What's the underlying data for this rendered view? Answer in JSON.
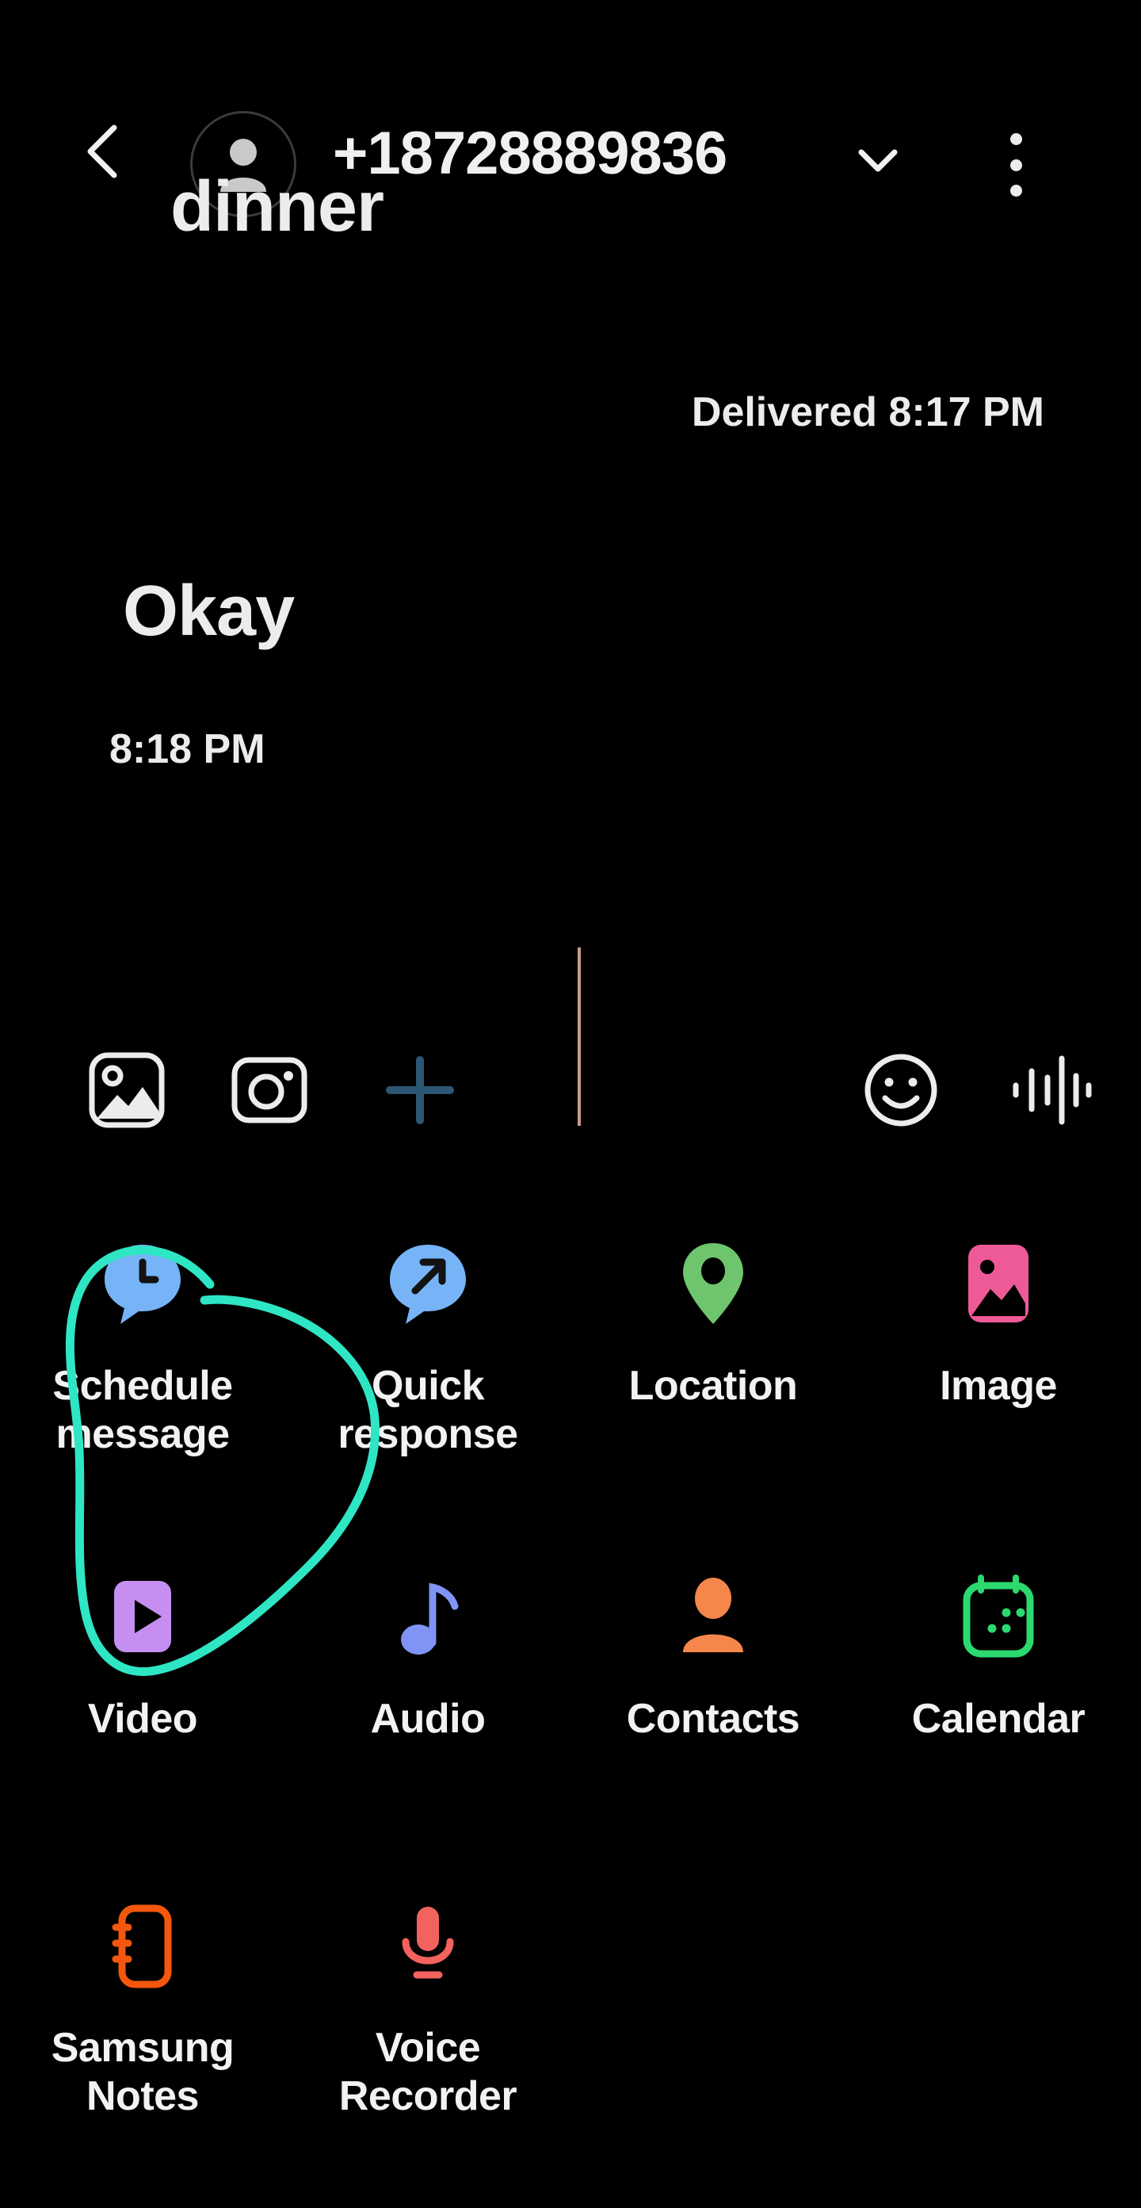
{
  "app": {
    "name": "Samsung Messages",
    "theme": "dark",
    "background_color": "#000000"
  },
  "header": {
    "back_icon": "chevron-left-icon",
    "avatar_icon": "person-avatar-icon",
    "contact": "+18728889836",
    "expand_icon": "chevron-down-icon",
    "overflow_icon": "more-vertical-icon"
  },
  "conversation": {
    "messages": [
      {
        "id": "msg-dinner",
        "text": "dinner",
        "direction": "incoming",
        "clipped": true
      },
      {
        "id": "msg-delivered",
        "text": "Delivered 8:17 PM",
        "direction": "outgoing-status"
      },
      {
        "id": "msg-okay",
        "text": "Okay",
        "direction": "incoming"
      },
      {
        "id": "msg-okay-time",
        "text": "8:18 PM",
        "direction": "incoming-timestamp"
      }
    ]
  },
  "input_toolbar": {
    "gallery_icon": "image-gallery-icon",
    "camera_icon": "camera-icon",
    "plus_icon": "plus-icon",
    "plus_color": "#2d5674",
    "cursor_color": "#c89b8a",
    "emoji_icon": "smiley-face-icon",
    "voice_icon": "voice-waveform-icon",
    "message_value": "",
    "message_placeholder": ""
  },
  "attachment_panel": {
    "items": [
      {
        "label": "Schedule message",
        "icon": "clock-bubble-icon",
        "color": "#76b4f7",
        "highlighted": true
      },
      {
        "label": "Quick response",
        "icon": "arrow-bubble-icon",
        "color": "#76b4f7",
        "highlighted": false
      },
      {
        "label": "Location",
        "icon": "map-pin-icon",
        "color": "#6ec56e",
        "highlighted": false
      },
      {
        "label": "Image",
        "icon": "photo-icon",
        "color": "#ee5998",
        "highlighted": false
      },
      {
        "label": "Video",
        "icon": "video-play-icon",
        "color": "#c58ef0",
        "highlighted": false
      },
      {
        "label": "Audio",
        "icon": "music-note-icon",
        "color": "#8094f5",
        "highlighted": false
      },
      {
        "label": "Contacts",
        "icon": "person-icon",
        "color": "#f6874c",
        "highlighted": false
      },
      {
        "label": "Calendar",
        "icon": "calendar-icon",
        "color": "#2bd96f",
        "highlighted": false
      },
      {
        "label": "Samsung Notes",
        "icon": "notebook-icon",
        "color": "#f4570d",
        "highlighted": false
      },
      {
        "label": "Voice Recorder",
        "icon": "microphone-icon",
        "color": "#f2625f",
        "highlighted": false
      }
    ]
  },
  "annotation": {
    "type": "hand-drawn-circle",
    "color": "#2fe6c4",
    "target": "Schedule message"
  }
}
